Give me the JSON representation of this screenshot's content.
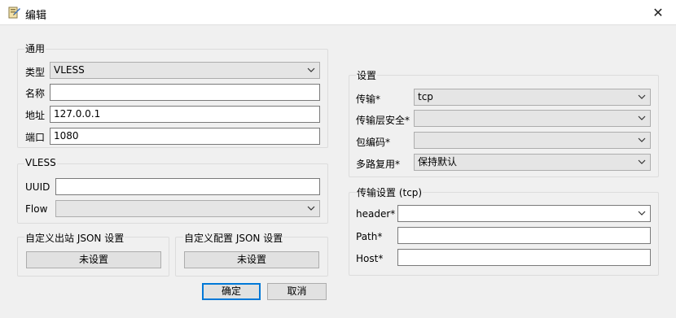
{
  "window": {
    "title": "编辑",
    "close_glyph": "✕"
  },
  "general": {
    "legend": "通用",
    "type_label": "类型",
    "type_value": "VLESS",
    "name_label": "名称",
    "name_value": "",
    "address_label": "地址",
    "address_value": "127.0.0.1",
    "port_label": "端口",
    "port_value": "1080"
  },
  "vless": {
    "legend": "VLESS",
    "uuid_label": "UUID",
    "uuid_value": "",
    "flow_label": "Flow",
    "flow_value": ""
  },
  "custom_outbound": {
    "legend": "自定义出站 JSON 设置",
    "button": "未设置"
  },
  "custom_config": {
    "legend": "自定义配置 JSON 设置",
    "button": "未设置"
  },
  "settings": {
    "legend": "设置",
    "transport_label": "传输*",
    "transport_value": "tcp",
    "tls_label": "传输层安全*",
    "tls_value": "",
    "packet_encoding_label": "包编码*",
    "packet_encoding_value": "",
    "mux_label": "多路复用*",
    "mux_value": "保持默认"
  },
  "transport_settings": {
    "legend": "传输设置 (tcp)",
    "header_label": "header*",
    "header_value": "",
    "path_label": "Path*",
    "path_value": "",
    "host_label": "Host*",
    "host_value": ""
  },
  "footer": {
    "ok": "确定",
    "cancel": "取消"
  },
  "icons": {
    "app": "app-icon",
    "close": "close-icon",
    "dropdown": "chevron-down-icon"
  }
}
